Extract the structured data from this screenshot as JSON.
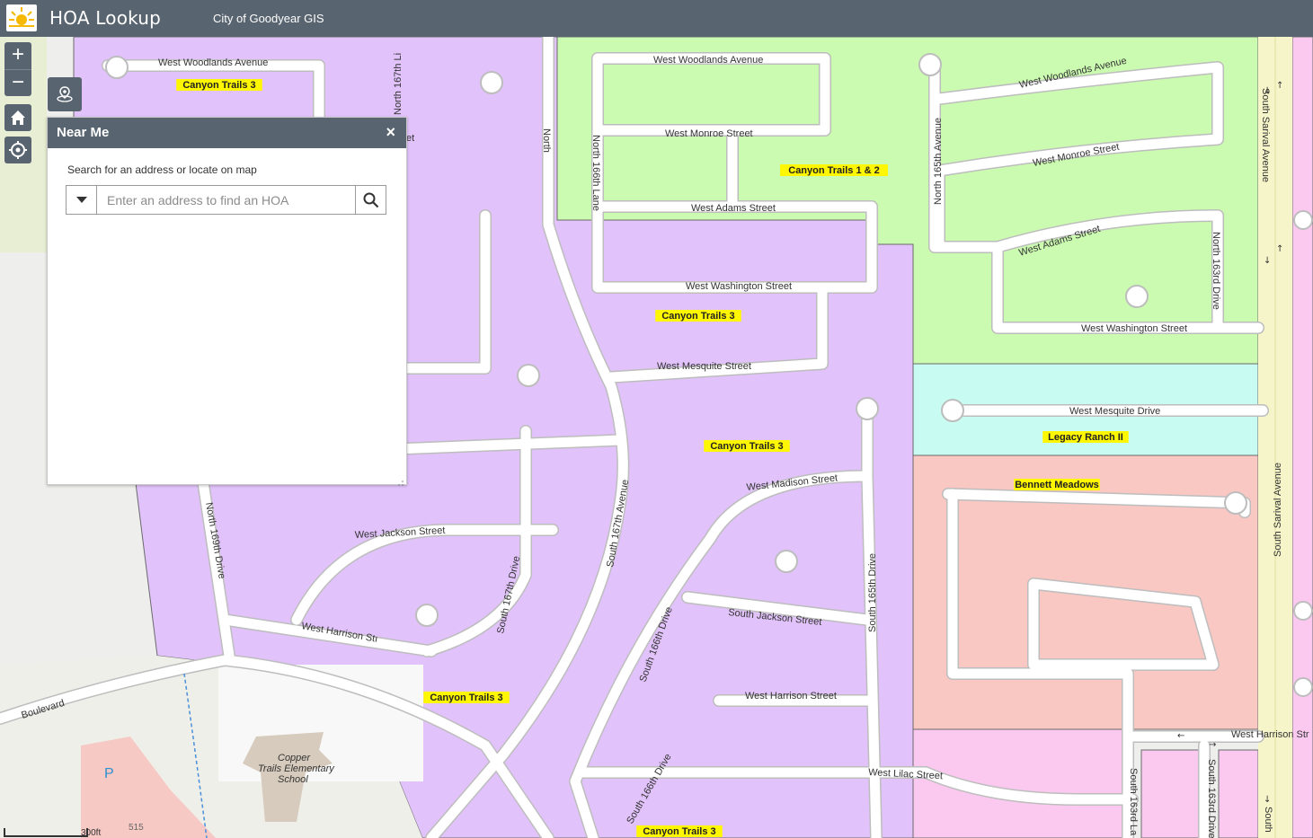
{
  "header": {
    "title": "HOA Lookup",
    "subtitle": "City of Goodyear GIS"
  },
  "zoom": {
    "in_label": "+",
    "out_label": "−"
  },
  "near_me": {
    "title": "Near Me",
    "close_label": "×",
    "hint": "Search for an address or locate on map",
    "search_placeholder": "Enter an address to find an HOA"
  },
  "scale_bar": {
    "label": "300ft"
  },
  "map": {
    "hoa_labels": {
      "ct3_top_left": "Canyon Trails 3",
      "ct12": "Canyon Trails 1 & 2",
      "ct3_mid": "Canyon Trails 3",
      "ct3_center": "Canyon Trails 3",
      "legacy": "Legacy Ranch II",
      "bennett": "Bennett Meadows",
      "ct3_lower": "Canyon Trails 3",
      "ct3_bottom": "Canyon Trails 3"
    },
    "streets": {
      "woodlands_left": "West Woodlands Avenue",
      "woodlands_mid": "West Woodlands Avenue",
      "woodlands_right": "West Woodlands Avenue",
      "monroe_mid": "West Monroe Street",
      "monroe_right": "West Monroe Street",
      "adams_mid": "West Adams Street",
      "adams_right": "West Adams Street",
      "washington_mid": "West Washington Street",
      "washington_right": "West Washington Street",
      "mesquite_st": "West Mesquite Street",
      "mesquite_dr": "West Mesquite Drive",
      "madison": "West Madison Street",
      "jackson_w": "West Jackson Street",
      "jackson_s": "South Jackson Street",
      "harrison_w": "West Harrison Stı",
      "harrison_e": "West Harrison Street",
      "harrison_far": "West Harrison Str",
      "lilac": "West Lilac Street",
      "n167_lane": "North 167th Li",
      "north_frag": "North",
      "n166_frag": "North 166th Lane",
      "n165": "North 165th Avenue",
      "n163": "North 163rd Drive",
      "sarival_n": "South Sarival Avenue",
      "sarival_s": "South Sarival Avenue",
      "sarival_bottom": "South",
      "n169": "North 169th Drive",
      "s167ave": "South 167th Avenue",
      "s167dr": "South 167th Drive",
      "s166dr": "South 166th Drive",
      "s166dr_b": "South 166th Drive",
      "s165dr": "South 165th Drive",
      "s163la": "South 163rd La",
      "s163dr": "South 163rd Drive",
      "boulevard": "Boulevard",
      "et_frag": "et"
    },
    "poi": {
      "school_line1": "Copper",
      "school_line2": "Trails Elementary",
      "school_line3": "School",
      "parking": "P",
      "building": "515"
    }
  },
  "colors": {
    "header": "#58646f",
    "purple_zone": "#e1c2fa",
    "green_zone": "#cbfbb0",
    "cyan_zone": "#c8fbf1",
    "salmon_zone": "#f9c8c3",
    "pink_zone": "#fbc9f0",
    "label_highlight": "#fff700",
    "road": "#ffffff"
  }
}
